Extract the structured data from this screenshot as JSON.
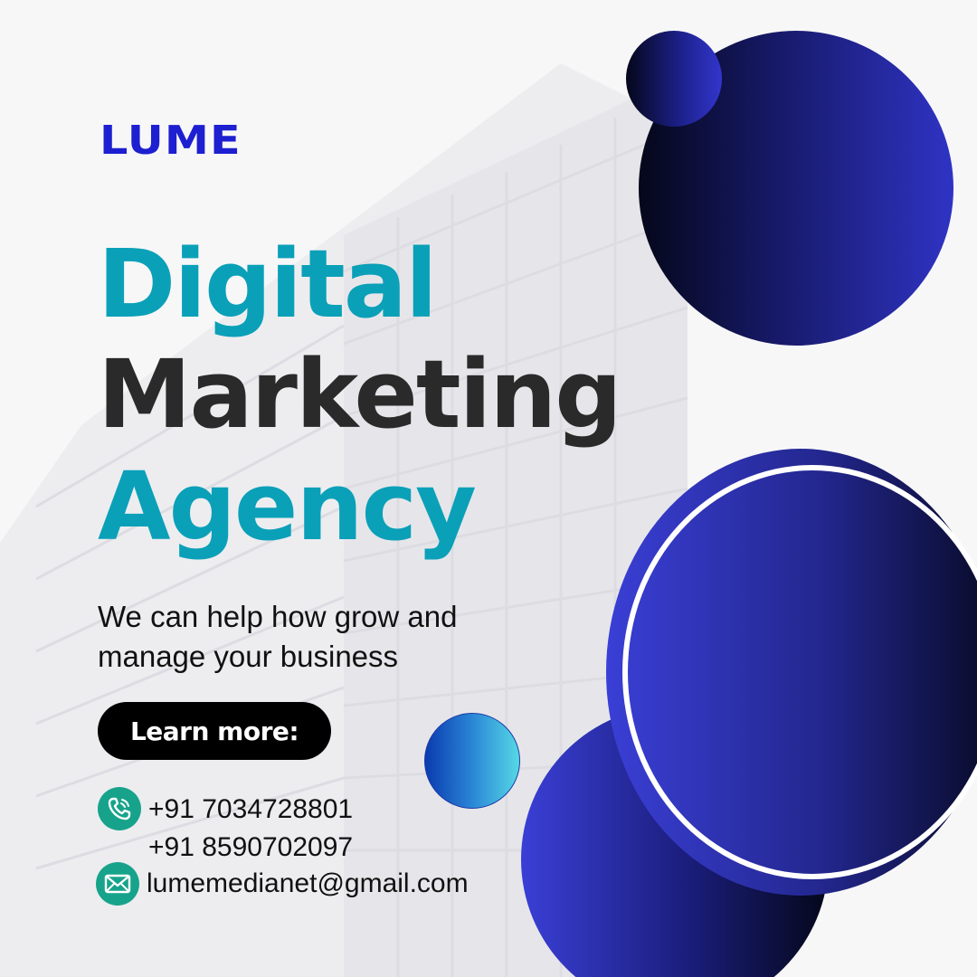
{
  "brand": {
    "logo": "LUME"
  },
  "headline": {
    "line1": "Digital",
    "line2": "Marketing",
    "line3": "Agency"
  },
  "tagline": {
    "line1": "We can help how grow and",
    "line2": "manage your business"
  },
  "cta": {
    "label": "Learn more:"
  },
  "contact": {
    "phone1": "+91 7034728801",
    "phone2": "+91 8590702097",
    "email": "lumemedianet@gmail.com"
  },
  "icons": {
    "phone": "phone-icon",
    "mail": "mail-icon"
  },
  "colors": {
    "logo": "#1d1fd1",
    "headline_accent": "#0aa0b8",
    "headline_dark": "#2a2a2a",
    "icon_bg": "#17a38b",
    "circle_blue": "#2f33c4",
    "circle_dark": "#05071a"
  }
}
